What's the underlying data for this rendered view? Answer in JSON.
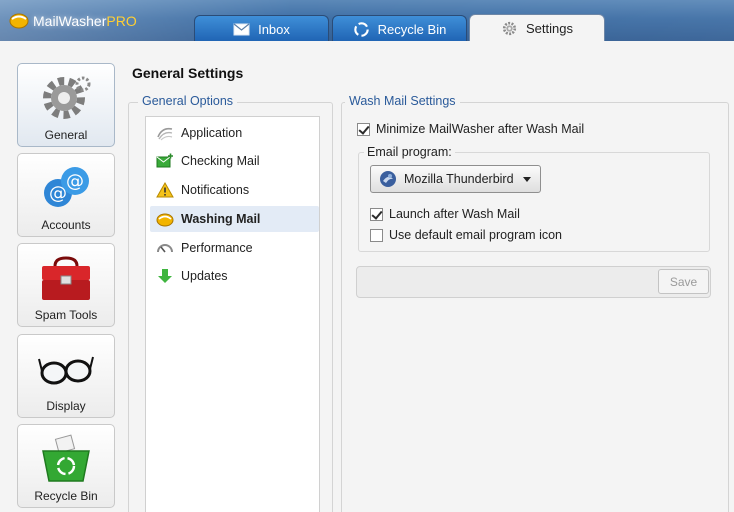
{
  "app": {
    "name": "MailWasher",
    "edition": "PRO"
  },
  "tabs": [
    {
      "label": "Inbox",
      "icon": "envelope-icon"
    },
    {
      "label": "Recycle Bin",
      "icon": "recycle-icon"
    },
    {
      "label": "Settings",
      "icon": "gear-icon",
      "active": true
    }
  ],
  "nav": [
    {
      "label": "General",
      "icon": "gear-icon",
      "active": true
    },
    {
      "label": "Accounts",
      "icon": "at-sign-icon"
    },
    {
      "label": "Spam Tools",
      "icon": "toolbox-icon"
    },
    {
      "label": "Display",
      "icon": "glasses-icon"
    },
    {
      "label": "Recycle Bin",
      "icon": "recycle-basket-icon"
    }
  ],
  "page_title": "General Settings",
  "general_options": {
    "title": "General Options",
    "items": [
      {
        "label": "Application",
        "icon": "swirl-icon"
      },
      {
        "label": "Checking Mail",
        "icon": "mail-check-icon"
      },
      {
        "label": "Notifications",
        "icon": "warning-icon"
      },
      {
        "label": "Washing Mail",
        "icon": "wash-icon",
        "selected": true
      },
      {
        "label": "Performance",
        "icon": "gauge-icon"
      },
      {
        "label": "Updates",
        "icon": "down-arrow-icon"
      }
    ]
  },
  "wash_mail": {
    "title": "Wash Mail Settings",
    "minimize_label": "Minimize MailWasher after Wash Mail",
    "minimize_checked": true,
    "email_program_label": "Email program:",
    "email_program_value": "Mozilla Thunderbird",
    "launch_label": "Launch after Wash Mail",
    "launch_checked": true,
    "default_icon_label": "Use default email program icon",
    "default_icon_checked": false,
    "save_label": "Save"
  },
  "colors": {
    "accent": "#2a5a9a",
    "tab_blue": "#1f63b3",
    "selection": "#e3ebf6"
  }
}
